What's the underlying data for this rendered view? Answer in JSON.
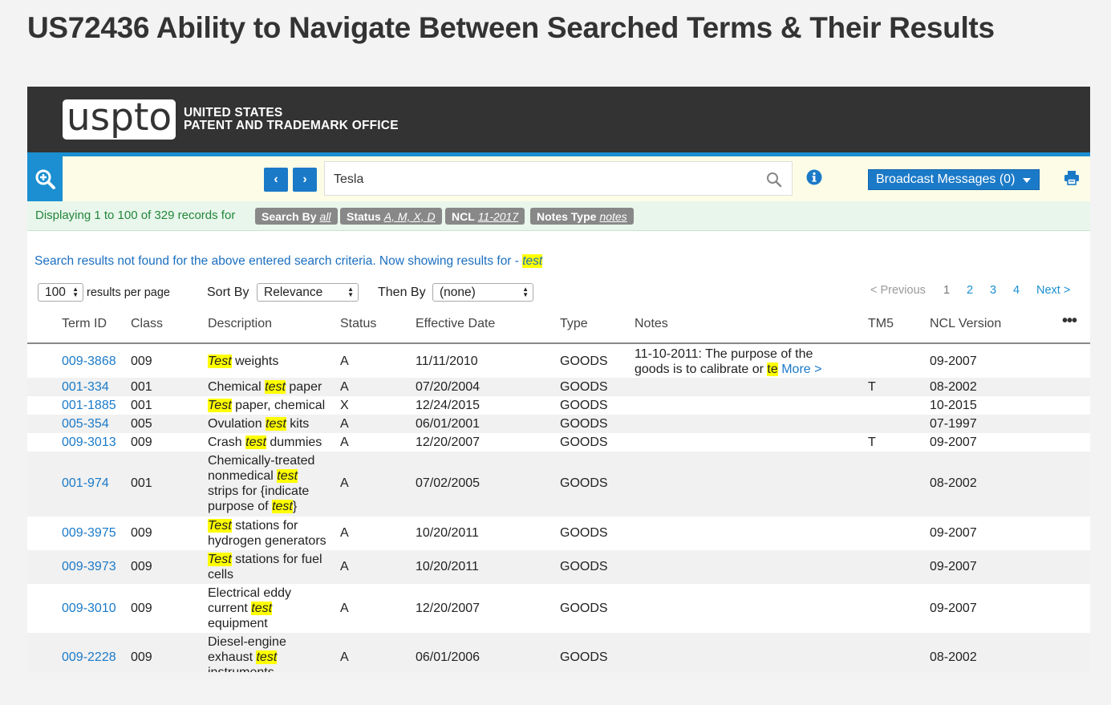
{
  "page_title": "US72436 Ability to Navigate Between Searched Terms & Their Results",
  "header": {
    "logo_text": "uspto",
    "office_line1": "UNITED STATES",
    "office_line2": "PATENT AND TRADEMARK OFFICE"
  },
  "search": {
    "prev_label": "‹",
    "next_label": "›",
    "value": "Tesla",
    "broadcast_label": "Broadcast Messages (0)"
  },
  "filters": {
    "summary": "Displaying 1 to 100 of 329 records for",
    "chips": [
      {
        "label": "Search By",
        "value": "all"
      },
      {
        "label": "Status",
        "value": "A, M, X, D"
      },
      {
        "label": "NCL",
        "value": "11-2017"
      },
      {
        "label": "Notes Type",
        "value": "notes"
      }
    ]
  },
  "notice": {
    "text": "Search results not found for the above entered search criteria. Now showing results for - ",
    "term": "test"
  },
  "controls": {
    "per_page_value": "100",
    "per_page_label": "results per page",
    "sort_by_label": "Sort By",
    "sort_by_value": "Relevance",
    "then_by_label": "Then By",
    "then_by_value": "(none)"
  },
  "pagination": {
    "previous": "< Previous",
    "pages": [
      "1",
      "2",
      "3",
      "4"
    ],
    "next": "Next >"
  },
  "table": {
    "columns": [
      "Term ID",
      "Class",
      "Description",
      "Status",
      "Effective Date",
      "Type",
      "Notes",
      "TM5",
      "NCL Version"
    ],
    "more_label": "More >",
    "rows": [
      {
        "term_id": "009-3868",
        "class": "009",
        "description": [
          [
            "Test",
            true
          ],
          [
            " weights",
            false
          ]
        ],
        "status": "A",
        "date": "11/11/2010",
        "type": "GOODS",
        "notes": [
          [
            "11-10-2011: The purpose of the goods is to calibrate or ",
            false
          ],
          [
            "te",
            true
          ]
        ],
        "has_more": true,
        "tm5": "",
        "ncl": "09-2007"
      },
      {
        "term_id": "001-334",
        "class": "001",
        "description": [
          [
            "Chemical ",
            false
          ],
          [
            "test",
            true
          ],
          [
            " paper",
            false
          ]
        ],
        "status": "A",
        "date": "07/20/2004",
        "type": "GOODS",
        "notes": [],
        "has_more": false,
        "tm5": "T",
        "ncl": "08-2002"
      },
      {
        "term_id": "001-1885",
        "class": "001",
        "description": [
          [
            "Test",
            true
          ],
          [
            " paper, chemical",
            false
          ]
        ],
        "status": "X",
        "date": "12/24/2015",
        "type": "GOODS",
        "notes": [],
        "has_more": false,
        "tm5": "",
        "ncl": "10-2015"
      },
      {
        "term_id": "005-354",
        "class": "005",
        "description": [
          [
            "Ovulation ",
            false
          ],
          [
            "test",
            true
          ],
          [
            " kits",
            false
          ]
        ],
        "status": "A",
        "date": "06/01/2001",
        "type": "GOODS",
        "notes": [],
        "has_more": false,
        "tm5": "",
        "ncl": "07-1997"
      },
      {
        "term_id": "009-3013",
        "class": "009",
        "description": [
          [
            "Crash ",
            false
          ],
          [
            "test",
            true
          ],
          [
            " dummies",
            false
          ]
        ],
        "status": "A",
        "date": "12/20/2007",
        "type": "GOODS",
        "notes": [],
        "has_more": false,
        "tm5": "T",
        "ncl": "09-2007"
      },
      {
        "term_id": "001-974",
        "class": "001",
        "description": [
          [
            "Chemically-treated nonmedical ",
            false
          ],
          [
            "test",
            true
          ],
          [
            " strips for {indicate purpose of ",
            false
          ],
          [
            "test",
            true
          ],
          [
            "}",
            false
          ]
        ],
        "status": "A",
        "date": "07/02/2005",
        "type": "GOODS",
        "notes": [],
        "has_more": false,
        "tm5": "",
        "ncl": "08-2002"
      },
      {
        "term_id": "009-3975",
        "class": "009",
        "description": [
          [
            "Test",
            true
          ],
          [
            " stations for hydrogen generators",
            false
          ]
        ],
        "status": "A",
        "date": "10/20/2011",
        "type": "GOODS",
        "notes": [],
        "has_more": false,
        "tm5": "",
        "ncl": "09-2007"
      },
      {
        "term_id": "009-3973",
        "class": "009",
        "description": [
          [
            "Test",
            true
          ],
          [
            " stations for fuel cells",
            false
          ]
        ],
        "status": "A",
        "date": "10/20/2011",
        "type": "GOODS",
        "notes": [],
        "has_more": false,
        "tm5": "",
        "ncl": "09-2007"
      },
      {
        "term_id": "009-3010",
        "class": "009",
        "description": [
          [
            "Electrical eddy current ",
            false
          ],
          [
            "test",
            true
          ],
          [
            " equipment",
            false
          ]
        ],
        "status": "A",
        "date": "12/20/2007",
        "type": "GOODS",
        "notes": [],
        "has_more": false,
        "tm5": "",
        "ncl": "09-2007"
      },
      {
        "term_id": "009-2228",
        "class": "009",
        "description": [
          [
            "Diesel-engine exhaust ",
            false
          ],
          [
            "test",
            true
          ],
          [
            " instruments",
            false
          ]
        ],
        "status": "A",
        "date": "06/01/2006",
        "type": "GOODS",
        "notes": [],
        "has_more": false,
        "tm5": "",
        "ncl": "08-2002"
      }
    ]
  },
  "colors": {
    "header_bg": "#333333",
    "accent_blue": "#1b8fd1",
    "button_blue": "#1b7ac8",
    "highlight": "#ffff00",
    "filter_green": "#22863a"
  }
}
